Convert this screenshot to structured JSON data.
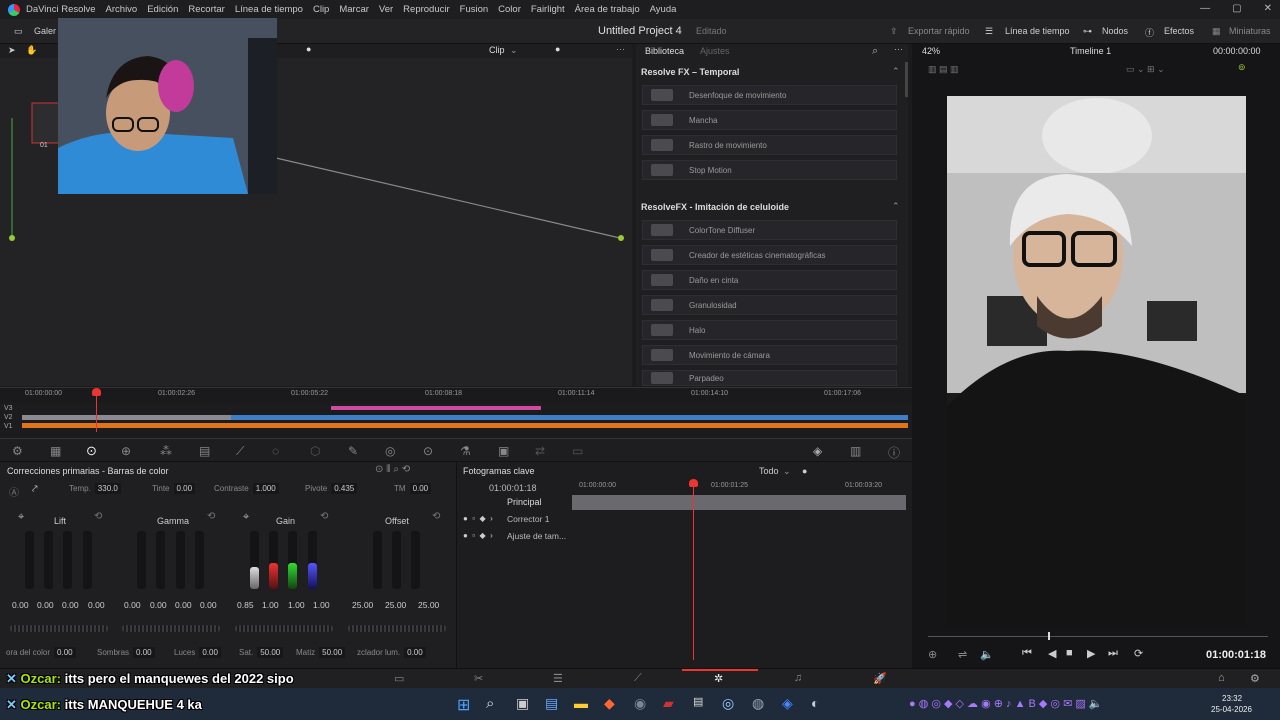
{
  "titlebar": {
    "menus": [
      "DaVinci Resolve",
      "Archivo",
      "Edición",
      "Recortar",
      "Línea de tiempo",
      "Clip",
      "Marcar",
      "Ver",
      "Reproducir",
      "Fusion",
      "Color",
      "Fairlight",
      "Área de trabajo",
      "Ayuda"
    ],
    "min": "—",
    "max": "▢",
    "close": "✕"
  },
  "topbar": {
    "gallery": "Galer",
    "project": "Untitled Project 4",
    "state": "Editado",
    "quick_export": "Exportar rápido",
    "timeline": "Línea de tiempo",
    "nodes": "Nodos",
    "effects": "Efectos",
    "thumbnails": "Miniaturas"
  },
  "nodes": {
    "clip_label": "Clip",
    "node_label": "01"
  },
  "library": {
    "tab_library": "Biblioteca",
    "tab_adjust": "Ajustes",
    "section1": "Resolve FX – Temporal",
    "items1": [
      "Desenfoque de movimiento",
      "Mancha",
      "Rastro de movimiento",
      "Stop Motion"
    ],
    "section2": "ResolveFX - Imitación de celuloide",
    "items2": [
      "ColorTone Diffuser",
      "Creador de estéticas cinematográficas",
      "Daño en cinta",
      "Granulosidad",
      "Halo",
      "Movimiento de cámara",
      "Parpadeo"
    ]
  },
  "viewer": {
    "zoom": "42%",
    "timeline_name": "Timeline 1",
    "tc_top": "00:00:00:00",
    "tc_bottom": "01:00:01:18"
  },
  "timeline": {
    "ticks": [
      "01:00:00:00",
      "01:00:02:26",
      "01:00:05:22",
      "01:00:08:18",
      "01:00:11:14",
      "01:00:14:10",
      "01:00:17:06"
    ],
    "tracks": [
      "V3",
      "V2",
      "V1"
    ]
  },
  "primaries": {
    "title": "Correcciones primarias - Barras de color",
    "temp_label": "Temp.",
    "temp": "330.0",
    "tint_label": "Tinte",
    "tint": "0.00",
    "contrast_label": "Contraste",
    "contrast": "1.000",
    "pivot_label": "Pivote",
    "pivot": "0.435",
    "tm_label": "TM",
    "tm": "0.00",
    "wheels": [
      {
        "name": "Lift",
        "vals": [
          "0.00",
          "0.00",
          "0.00",
          "0.00"
        ]
      },
      {
        "name": "Gamma",
        "vals": [
          "0.00",
          "0.00",
          "0.00",
          "0.00"
        ]
      },
      {
        "name": "Gain",
        "vals": [
          "0.85",
          "1.00",
          "1.00",
          "1.00"
        ]
      },
      {
        "name": "Offset",
        "vals": [
          "25.00",
          "25.00",
          "25.00"
        ]
      }
    ],
    "bottom": {
      "l1": "ora del color",
      "v1": "0.00",
      "l2": "Sombras",
      "v2": "0.00",
      "l3": "Luces",
      "v3": "0.00",
      "l4": "Sat.",
      "v4": "50.00",
      "l5": "Matiz",
      "v5": "50.00",
      "l6": "zclador lum.",
      "v6": "0.00"
    }
  },
  "keyframes": {
    "title": "Fotogramas clave",
    "filter": "Todo",
    "tc": "01:00:01:18",
    "ticks": [
      "01:00:00:00",
      "01:00:01:25",
      "01:00:03:20"
    ],
    "rows": [
      "Principal",
      "Corrector 1",
      "Ajuste de tam..."
    ]
  },
  "chat": {
    "line1_user": "Ozcar:",
    "line1_text": "itts pero el manquewes del 2022 sipo",
    "line2_user": "Ozcar:",
    "line2_text": "itts MANQUEHUE 4 ka"
  },
  "taskbar": {
    "time": "23:32",
    "date": "25-04-2026"
  }
}
